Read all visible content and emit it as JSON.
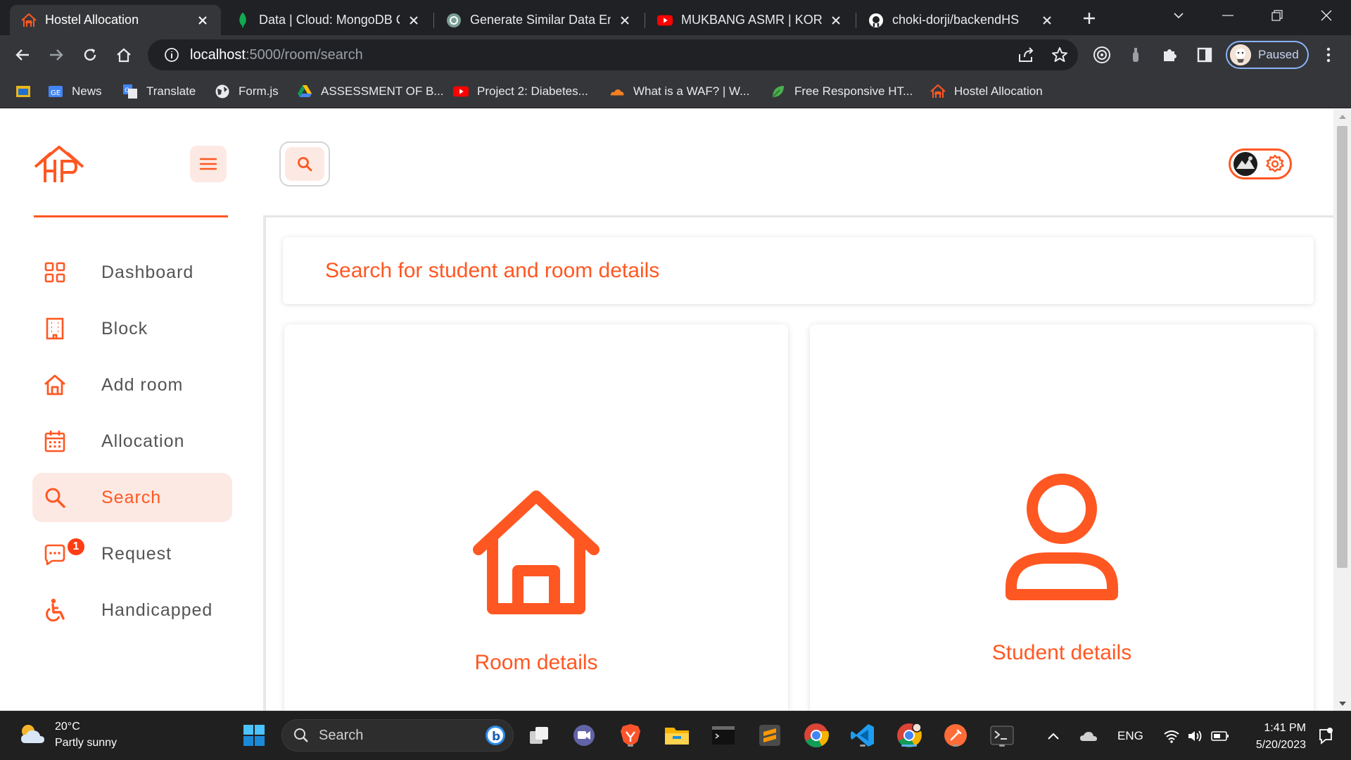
{
  "browser": {
    "tabs": [
      {
        "title": "Hostel Allocation",
        "active": true
      },
      {
        "title": "Data | Cloud: MongoDB C",
        "active": false
      },
      {
        "title": "Generate Similar Data Ent",
        "active": false
      },
      {
        "title": "MUKBANG ASMR | KOREA",
        "active": false
      },
      {
        "title": "choki-dorji/backendHS",
        "active": false
      }
    ],
    "url_host": "localhost",
    "url_path": ":5000/room/search",
    "profile_label": "Paused",
    "bookmarks": [
      {
        "label": "",
        "icon": "apps-icon"
      },
      {
        "label": "News",
        "icon": "google-news-icon"
      },
      {
        "label": "Translate",
        "icon": "google-translate-icon"
      },
      {
        "label": "Form.js",
        "icon": "globe-icon"
      },
      {
        "label": "ASSESSMENT OF B...",
        "icon": "google-drive-icon"
      },
      {
        "label": "Project 2: Diabetes...",
        "icon": "youtube-icon"
      },
      {
        "label": "What is a WAF? | W...",
        "icon": "cloudflare-icon"
      },
      {
        "label": "Free Responsive HT...",
        "icon": "leaf-icon"
      },
      {
        "label": "Hostel Allocation",
        "icon": "hostel-logo-icon"
      }
    ]
  },
  "app": {
    "accent_color": "#ff5722",
    "nav": [
      {
        "label": "Dashboard",
        "icon": "dashboard-icon",
        "active": false
      },
      {
        "label": "Block",
        "icon": "building-icon",
        "active": false
      },
      {
        "label": "Add room",
        "icon": "home-icon",
        "active": false
      },
      {
        "label": "Allocation",
        "icon": "calendar-icon",
        "active": false
      },
      {
        "label": "Search",
        "icon": "search-icon",
        "active": true
      },
      {
        "label": "Request",
        "icon": "chat-icon",
        "active": false,
        "badge": "1"
      },
      {
        "label": "Handicapped",
        "icon": "wheelchair-icon",
        "active": false
      }
    ],
    "page_title": "Search for student and room details",
    "cards": [
      {
        "label": "Room details",
        "icon": "home-icon"
      },
      {
        "label": "Student details",
        "icon": "user-icon"
      }
    ]
  },
  "taskbar": {
    "weather_temp": "20°C",
    "weather_desc": "Partly sunny",
    "search_placeholder": "Search",
    "language": "ENG",
    "time": "1:41 PM",
    "date": "5/20/2023",
    "apps": [
      "start-icon",
      "file-explorer-icon",
      "teams-icon",
      "brave-icon",
      "folder-icon",
      "terminal-icon",
      "sublime-icon",
      "chrome-icon",
      "vscode-icon",
      "chrome-profile-icon",
      "postman-icon",
      "powershell-icon"
    ]
  }
}
